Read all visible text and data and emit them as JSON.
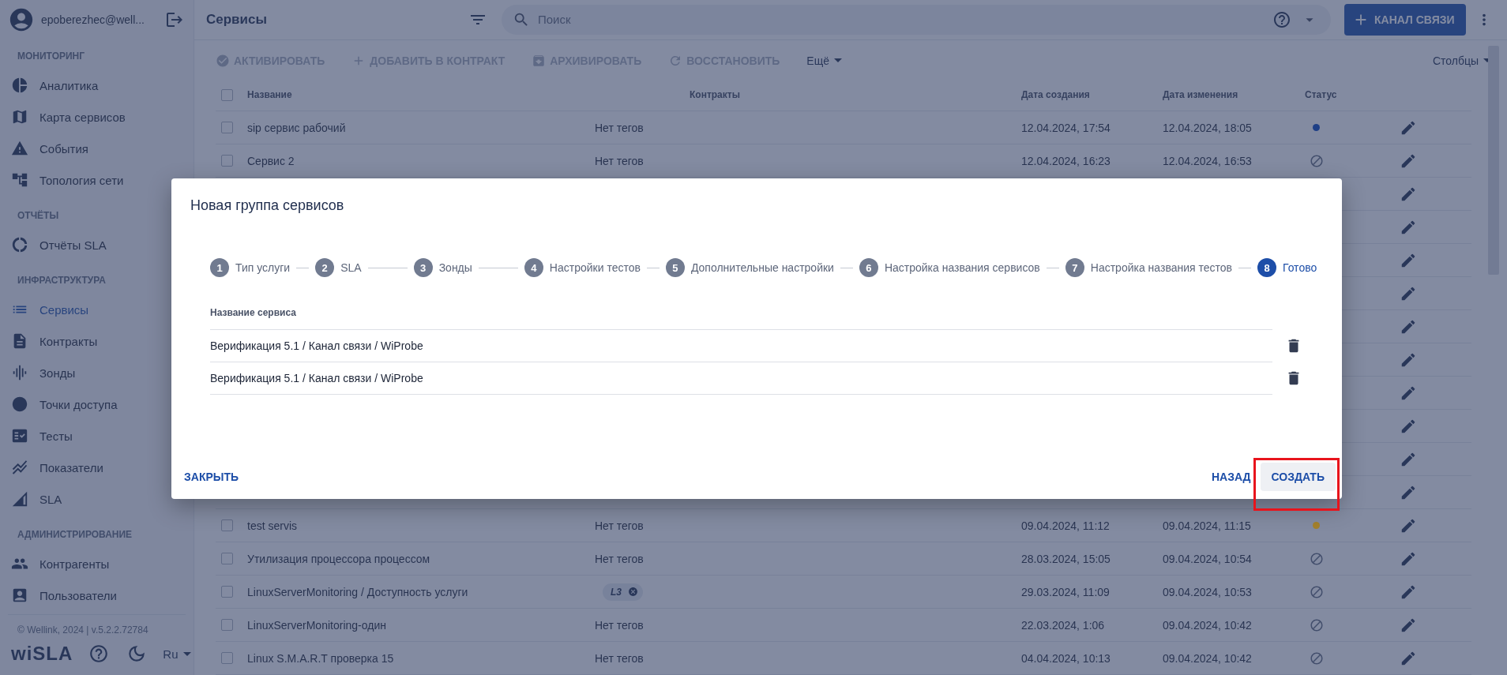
{
  "sidebar": {
    "user": "epoberezhec@well...",
    "sections": [
      {
        "title": "МОНИТОРИНГ",
        "items": [
          {
            "label": "Аналитика",
            "selected": false
          },
          {
            "label": "Карта сервисов",
            "selected": false
          },
          {
            "label": "События",
            "selected": false
          },
          {
            "label": "Топология сети",
            "selected": false
          }
        ]
      },
      {
        "title": "ОТЧЁТЫ",
        "items": [
          {
            "label": "Отчёты SLA",
            "selected": false
          }
        ]
      },
      {
        "title": "ИНФРАСТРУКТУРА",
        "items": [
          {
            "label": "Сервисы",
            "selected": true
          },
          {
            "label": "Контракты",
            "selected": false
          },
          {
            "label": "Зонды",
            "selected": false
          },
          {
            "label": "Точки доступа",
            "selected": false
          },
          {
            "label": "Тесты",
            "selected": false
          },
          {
            "label": "Показатели",
            "selected": false
          },
          {
            "label": "SLA",
            "selected": false
          }
        ]
      },
      {
        "title": "АДМИНИСТРИРОВАНИЕ",
        "items": [
          {
            "label": "Контрагенты",
            "selected": false
          },
          {
            "label": "Пользователи",
            "selected": false
          }
        ]
      }
    ],
    "footer": "© Wellink, 2024 | v.5.2.2.72784",
    "logo": "wiSLA",
    "language": "Ru"
  },
  "topbar": {
    "title": "Сервисы",
    "search": {
      "placeholder": "Поиск"
    },
    "primary_button": "КАНАЛ СВЯЗИ"
  },
  "toolbar": {
    "actions": [
      {
        "label": "АКТИВИРОВАТЬ",
        "disabled": true
      },
      {
        "label": "ДОБАВИТЬ В КОНТРАКТ",
        "disabled": true
      },
      {
        "label": "АРХИВИРОВАТЬ",
        "disabled": true
      },
      {
        "label": "ВОССТАНОВИТЬ",
        "disabled": true
      }
    ],
    "more": "Ещё",
    "columns_button": "Столбцы"
  },
  "table": {
    "select_all_checked": false,
    "columns": [
      "Название",
      "Контракты",
      "Дата создания",
      "Дата изменения",
      "Статус"
    ],
    "rows": [
      {
        "kind": "full",
        "checked": false,
        "name": "sip сервис рабочий",
        "contracts": "Нет тегов",
        "created": "12.04.2024, 17:54",
        "modified": "12.04.2024, 18:05",
        "status": {
          "kind": "dot",
          "color": "#1e3f86"
        }
      },
      {
        "kind": "full",
        "checked": false,
        "name": "Сервис 2",
        "contracts": "Нет тегов",
        "created": "12.04.2024, 16:23",
        "modified": "12.04.2024, 16:53",
        "status": {
          "kind": "off"
        }
      },
      {
        "kind": "covered"
      },
      {
        "kind": "covered"
      },
      {
        "kind": "covered"
      },
      {
        "kind": "covered"
      },
      {
        "kind": "covered"
      },
      {
        "kind": "covered"
      },
      {
        "kind": "covered"
      },
      {
        "kind": "covered"
      },
      {
        "kind": "covered"
      },
      {
        "kind": "covered"
      },
      {
        "kind": "full",
        "checked": false,
        "name": "test servis",
        "contracts": "Нет тегов",
        "created": "09.04.2024, 11:12",
        "modified": "09.04.2024, 11:15",
        "status": {
          "kind": "dot",
          "color": "#a3802c"
        }
      },
      {
        "kind": "full",
        "checked": false,
        "name": "Утилизация процессора процессом",
        "contracts": "Нет тегов",
        "created": "28.03.2024, 15:05",
        "modified": "09.04.2024, 10:54",
        "status": {
          "kind": "off"
        }
      },
      {
        "kind": "full",
        "checked": false,
        "name": "LinuxServerMonitoring / Доступность услуги",
        "tags": [
          "L3"
        ],
        "created": "29.03.2024, 11:09",
        "modified": "09.04.2024, 10:53",
        "status": {
          "kind": "off"
        }
      },
      {
        "kind": "full",
        "checked": false,
        "name": "LinuxServerMonitoring-один",
        "contracts": "Нет тегов",
        "created": "22.03.2024, 1:06",
        "modified": "09.04.2024, 10:42",
        "status": {
          "kind": "off"
        }
      },
      {
        "kind": "full",
        "checked": false,
        "name": "Linux S.M.A.R.T проверка 15",
        "contracts": "Нет тегов",
        "created": "04.04.2024, 10:13",
        "modified": "09.04.2024, 10:42",
        "status": {
          "kind": "off"
        }
      }
    ]
  },
  "dialog": {
    "title": "Новая группа сервисов",
    "steps": [
      {
        "number": "1",
        "label": "Тип услуги",
        "active": false
      },
      {
        "number": "2",
        "label": "SLA",
        "active": false
      },
      {
        "number": "3",
        "label": "Зонды",
        "active": false
      },
      {
        "number": "4",
        "label": "Настройки тестов",
        "active": false
      },
      {
        "number": "5",
        "label": "Дополнительные настройки",
        "active": false
      },
      {
        "number": "6",
        "label": "Настройка названия сервисов",
        "active": false
      },
      {
        "number": "7",
        "label": "Настройка названия тестов",
        "active": false
      },
      {
        "number": "8",
        "label": "Готово",
        "active": true
      }
    ],
    "list_heading": "Название сервиса",
    "services": [
      "Верификация 5.1 / Канал связи / WiProbe",
      "Верификация 5.1 / Канал связи / WiProbe"
    ],
    "close_button": "ЗАКРЫТЬ",
    "back_button": "НАЗАД",
    "create_button": {
      "label": "СОЗДАТЬ",
      "hovered": true
    }
  }
}
